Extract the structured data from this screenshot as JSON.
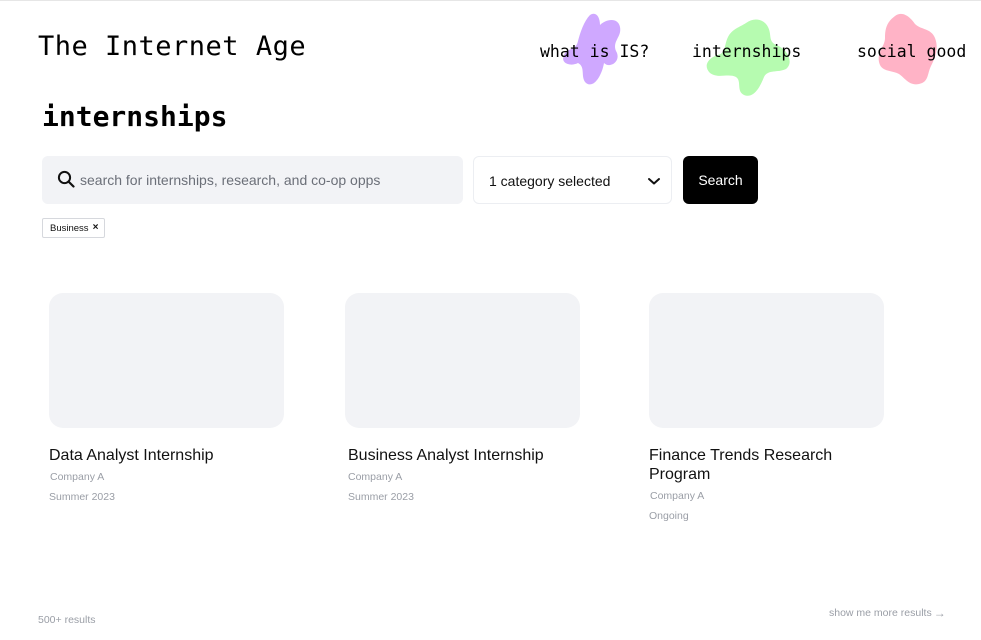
{
  "header": {
    "brand": "The Internet Age",
    "nav": [
      {
        "label": "what is IS?",
        "blob_color": "#cfa8ff"
      },
      {
        "label": "internships",
        "blob_color": "#b6fbb0"
      },
      {
        "label": "social good",
        "blob_color": "#ffb3c6"
      }
    ]
  },
  "page": {
    "title": "internships"
  },
  "search": {
    "placeholder": "search for internships, research, and co-op opps",
    "value": "",
    "category_label": "1 category selected",
    "button_label": "Search"
  },
  "filters": {
    "chips": [
      {
        "label": "Business",
        "remove": "×"
      }
    ]
  },
  "results": [
    {
      "title": "Data Analyst Internship",
      "company": "Company A",
      "term": "Summer 2023"
    },
    {
      "title": "Business Analyst Internship",
      "company": "Company A",
      "term": "Summer 2023"
    },
    {
      "title": "Finance Trends Research Program",
      "company": "Company A",
      "term": "Ongoing"
    }
  ],
  "footer": {
    "count": "500+ results",
    "more": "show me more results",
    "more_arrow": "→"
  },
  "colors": {
    "accent": "#000000",
    "placeholder_bg": "#f2f3f6",
    "muted_text": "#9a9ea6"
  }
}
